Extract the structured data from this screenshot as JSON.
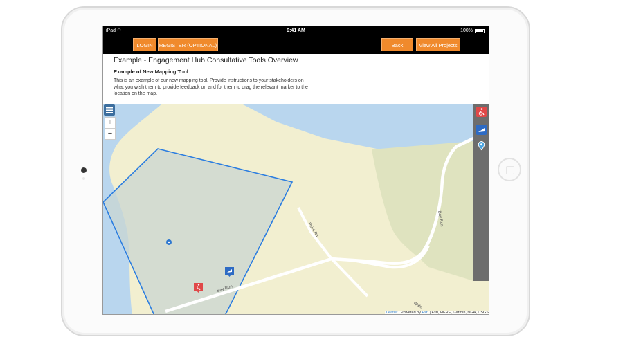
{
  "device": {
    "carrier": "iPad",
    "time": "9:41 AM",
    "battery": "100%"
  },
  "nav": {
    "login_label": "LOGIN",
    "register_label": "REGISTER (OPTIONAL)",
    "back_label": "Back",
    "view_all_label": "View All Projects"
  },
  "page": {
    "title": "Example - Engagement Hub Consultative Tools Overview",
    "subtitle": "Example of New Mapping Tool",
    "description": "This is an example of our new mapping tool. Provide instructions to your stakeholders on what you wish them to provide feedback on and for them to drag the relevant marker to the location on the map."
  },
  "map": {
    "zoom_in": "+",
    "zoom_out": "−",
    "road_labels": [
      "Point Rd",
      "Bay Run",
      "Bay Run",
      "Wate"
    ],
    "attribution_leaflet": "Leaflet",
    "attribution_powered": " | Powered by ",
    "attribution_esri": "Esri",
    "attribution_rest": " | Esri, HERE, Garmin, NGA, USGS",
    "colors": {
      "water": "#b9d6ee",
      "land": "#f2efd0",
      "park": "#dfe3bf",
      "polygon_fill": "#d2dcd4",
      "polygon_stroke": "#2b7de0",
      "accent": "#f08a2c"
    },
    "markers": [
      "wheelchair-marker",
      "sign-marker",
      "info-pin-marker"
    ],
    "panel_icons": [
      "wheelchair-icon",
      "sign-icon",
      "map-pin-icon",
      "square-icon"
    ]
  }
}
